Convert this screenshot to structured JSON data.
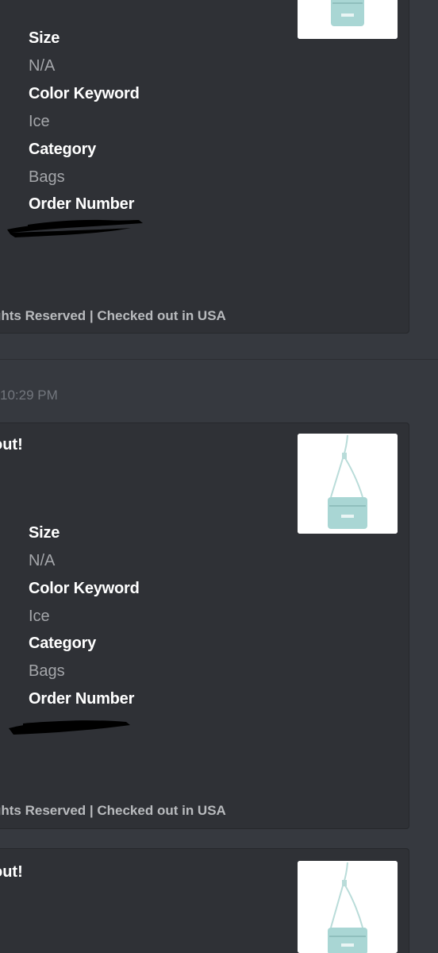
{
  "messages": [
    {
      "fields": [
        {
          "name": "Size",
          "value": "N/A"
        },
        {
          "name": "Color Keyword",
          "value": "Ice"
        },
        {
          "name": "Category",
          "value": "Bags"
        },
        {
          "name": "Order Number",
          "value": ""
        }
      ],
      "footer": "ghts Reserved | Checked out in USA",
      "thumbnail_icon": "bag-thumbnail-image"
    },
    {
      "timestamp": "10:29 PM",
      "title": "out!",
      "fields": [
        {
          "name": "Size",
          "value": "N/A"
        },
        {
          "name": "Color Keyword",
          "value": "Ice"
        },
        {
          "name": "Category",
          "value": "Bags"
        },
        {
          "name": "Order Number",
          "value": ""
        }
      ],
      "footer": "ghts Reserved | Checked out in USA",
      "thumbnail_icon": "bag-thumbnail-image"
    },
    {
      "title": "out!",
      "thumbnail_icon": "bag-thumbnail-image"
    }
  ],
  "colors": {
    "background": "#36393f",
    "embed_background": "#2f3136",
    "field_value": "#a4a6aa",
    "bag_color": "#a9d6d4"
  }
}
